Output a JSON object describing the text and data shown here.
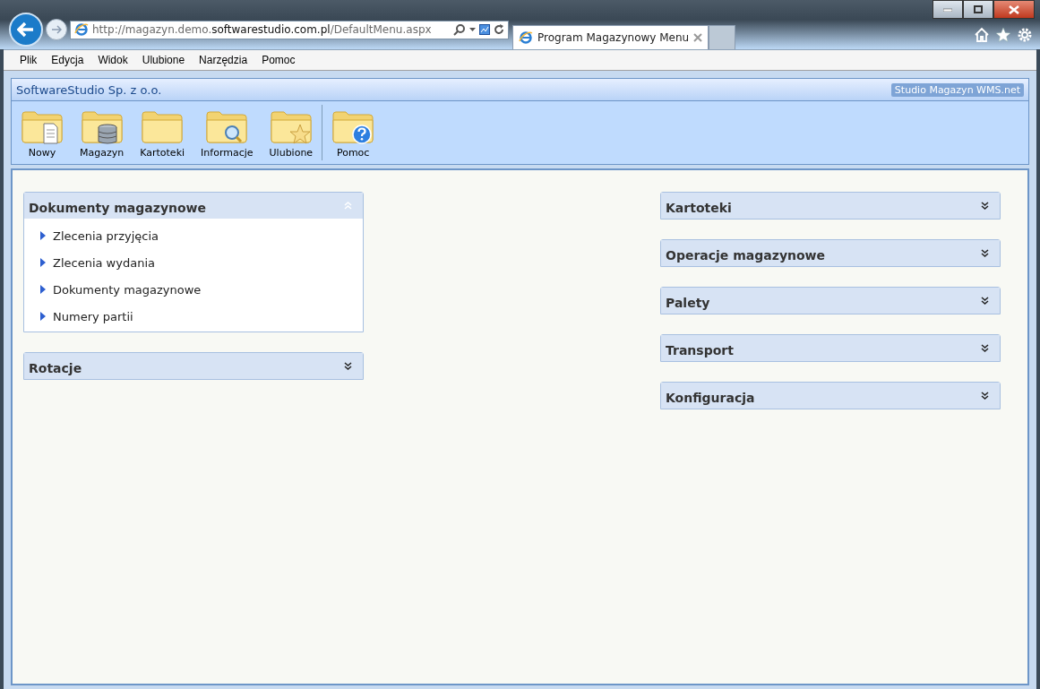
{
  "browser": {
    "address": {
      "prefix": "http://magazyn.demo.",
      "domain": "softwarestudio.com.pl",
      "path": "/DefaultMenu.aspx"
    },
    "tabs": [
      {
        "title": "Program Magazynowy Menu",
        "selected": true
      }
    ],
    "menu": [
      "Plik",
      "Edycja",
      "Widok",
      "Ulubione",
      "Narzędzia",
      "Pomoc"
    ]
  },
  "app": {
    "company": "SoftwareStudio Sp. z o.o.",
    "product": "Studio Magazyn WMS.net",
    "toolbar_groups": [
      [
        {
          "label": "Nowy"
        },
        {
          "label": "Magazyn"
        },
        {
          "label": "Kartoteki"
        },
        {
          "label": "Informacje"
        },
        {
          "label": "Ulubione"
        }
      ],
      [
        {
          "label": "Pomoc"
        }
      ]
    ],
    "columns": [
      [
        {
          "title": "Dokumenty magazynowe",
          "expanded": true,
          "items": [
            "Zlecenia przyjęcia",
            "Zlecenia wydania",
            "Dokumenty magazynowe",
            "Numery partii"
          ]
        },
        {
          "title": "Rotacje",
          "expanded": false
        }
      ],
      [
        {
          "title": "Kartoteki",
          "expanded": false
        },
        {
          "title": "Operacje magazynowe",
          "expanded": false
        },
        {
          "title": "Palety",
          "expanded": false
        },
        {
          "title": "Transport",
          "expanded": false
        },
        {
          "title": "Konfiguracja",
          "expanded": false
        }
      ]
    ]
  }
}
